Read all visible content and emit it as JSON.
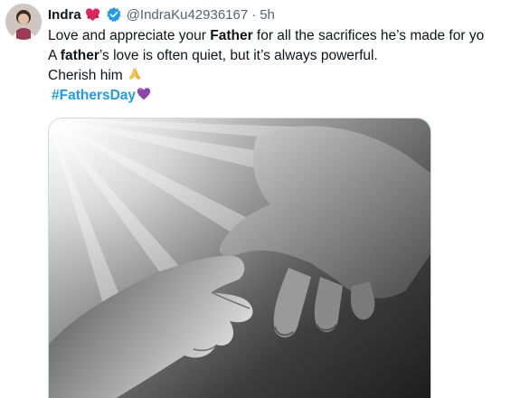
{
  "tweet": {
    "author_name": "Indra",
    "author_handle": "@IndraKu42936167",
    "separator": "·",
    "time_ago": "5h",
    "text": {
      "line1_pre": "Love and appreciate your ",
      "line1_bold": "Father",
      "line1_post": " for all the sacrifices he’s made for yo",
      "line2_pre": "A ",
      "line2_bold": "father",
      "line2_post": "’s love is often quiet, but it’s always powerful.",
      "line3": "Cherish him ",
      "hashtag": "#FathersDay"
    },
    "icons": {
      "name_emoji": "heart-with-ribbon-icon",
      "verified": "verified-badge-icon",
      "cherish_emoji": "folded-hands-icon",
      "hashtag_emoji": "purple-heart-icon"
    },
    "colors": {
      "verified": "#1d9bf0",
      "hashtag": "#1d9bf0",
      "muted": "#536471"
    }
  }
}
